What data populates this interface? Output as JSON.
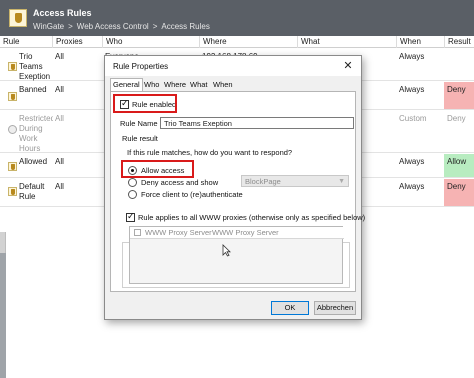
{
  "header": {
    "title": "Access Rules",
    "breadcrumb": [
      "WinGate",
      "Web Access Control",
      "Access Rules"
    ],
    "separator": ">"
  },
  "columns": [
    "Rule",
    "Proxies",
    "Who",
    "Where",
    "What",
    "When",
    "Result"
  ],
  "rows": [
    {
      "rule": "Trio Teams Exeption",
      "proxies": "All",
      "who": "Everyone",
      "where": "192.168.178.69",
      "what": "",
      "when": "Always",
      "result": ""
    },
    {
      "rule": "Banned",
      "proxies": "All",
      "who": "",
      "where": "",
      "what": "",
      "when": "Always",
      "result": "Deny"
    },
    {
      "rule": "Restricted During Work Hours",
      "proxies": "All",
      "who": "",
      "where": "",
      "what": "",
      "when": "Custom",
      "result": "Deny"
    },
    {
      "rule": "Allowed",
      "proxies": "All",
      "who": "",
      "where": "",
      "what": "",
      "when": "Always",
      "result": "Allow"
    },
    {
      "rule": "Default Rule",
      "proxies": "All",
      "who": "",
      "where": "",
      "what": "",
      "when": "Always",
      "result": "Deny"
    }
  ],
  "colors": {
    "deny": "#f6b3b3",
    "allow": "#b8ecc0",
    "highlight": "#d91a1a",
    "header_bg": "#5a5f66"
  },
  "dialog": {
    "title": "Rule Properties",
    "close_glyph": "✕",
    "tabs": [
      "General",
      "Who",
      "Where",
      "What",
      "When"
    ],
    "active_tab": "General",
    "rule_enabled_label": "Rule enabled",
    "rule_name_label": "Rule Name",
    "rule_name_value": "Trio Teams Exeption",
    "rule_result_label": "Rule result",
    "respond_question": "If this rule matches, how do you want to respond?",
    "options": [
      "Allow access",
      "Deny access and show",
      "Force client to (re)authenticate"
    ],
    "selected_option": "Allow access",
    "block_page_value": "BlockPage",
    "applies_label": "Rule applies to all WWW proxies (otherwise only as specified below)",
    "list_columns": [
      "WWW Proxy Server",
      "WWW Proxy Server"
    ],
    "ok_label": "OK",
    "cancel_label": "Abbrechen"
  }
}
